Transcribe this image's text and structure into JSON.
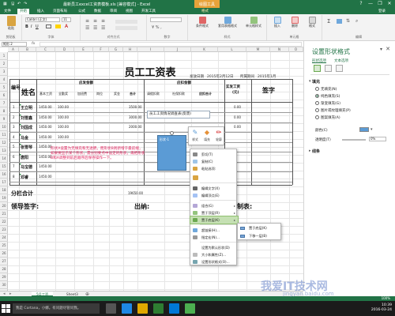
{
  "window": {
    "title": "最新员工excel工资表模板.xls [兼容模式] - Excel",
    "context_tab": "绘图工具",
    "controls": [
      "?",
      "—",
      "❐",
      "✕"
    ]
  },
  "ribbon": {
    "tabs": [
      "文件",
      "开始",
      "插入",
      "页面布局",
      "公式",
      "数据",
      "审阅",
      "视图",
      "开发工具",
      "格式"
    ],
    "active_tab": "开始",
    "groups": [
      "剪贴板",
      "字体",
      "对齐方式",
      "数字",
      "样式",
      "单元格",
      "编辑"
    ],
    "font_name": "Calibri (正文)",
    "font_size": "11",
    "buttons": {
      "paste": "粘贴",
      "conditional": "条件格式",
      "table_fmt": "套用表格格式",
      "cell_style": "单元格样式",
      "insert": "插入",
      "delete": "删除",
      "format": "格式"
    },
    "user": "登录"
  },
  "formula_bar": {
    "name_box": "矩形 2",
    "fx": "fx"
  },
  "columns": [
    "A",
    "B",
    "C",
    "D",
    "E",
    "F",
    "G",
    "H",
    "I",
    "J",
    "K",
    "L",
    "M",
    "N",
    "O"
  ],
  "rows": [
    "1",
    "2",
    "3",
    "4",
    "5",
    "6",
    "7",
    "8",
    "9",
    "10",
    "11",
    "12",
    "13",
    "14",
    "15",
    "16",
    "17",
    "18",
    "19",
    "20",
    "21",
    "22",
    "23",
    "24",
    "25",
    "26",
    "27",
    "28",
    "29",
    "30"
  ],
  "sheet": {
    "title": "员工工资表",
    "date_label": "发放日期",
    "date_value": "2015年2月12日",
    "period": "所属期间",
    "period_value": "2015年1月",
    "col_no": "编号",
    "col_name": "姓名",
    "group_payable": "应发金额",
    "group_deduct": "应扣金额",
    "col_sub": [
      "基本工资",
      "全勤奖",
      "加班费",
      "岗位",
      "奖金"
    ],
    "col_total": "合计",
    "col_deduct_sub": [
      "请假扣款",
      "社保扣款",
      "应扣合计"
    ],
    "col_actual": "实发工资",
    "col_actual_unit": "(元)",
    "col_sign": "签字",
    "ids": [
      "1",
      "2",
      "3",
      "4",
      "5",
      "6",
      "7",
      "8"
    ],
    "names": [
      "王立明",
      "刘雪鑫",
      "刘国成",
      "马金",
      "张雪琴",
      "唐阳",
      "马宝德",
      "邓睿"
    ],
    "base": [
      "1450.00",
      "1450.00",
      "1450.00",
      "1450.00",
      "1450.00",
      "1450.00",
      "1450.00",
      "1450.00"
    ],
    "bonus": [
      "100.00",
      "100.00",
      "100.00",
      "100.00"
    ],
    "totals": [
      "3500.00",
      "3000.00",
      "2000.00"
    ],
    "actuals": [
      "0.00",
      "0.00",
      "0.00"
    ],
    "subtotal_label": "分栏合计",
    "subtotal_value": "19650.00",
    "leader_sign": "领导签字:",
    "cashier": "出纳:",
    "maker": "制表:",
    "red_note": "形状A设置为无填充和无透明，而形状B则新增于最前端，如果要显示某个形状，需分别要点中设定的形状，再把形状B和A调整到前后顺序后保存操作一下。",
    "overlay_text": "员工工资情况调查表(反馈)",
    "shape_label": "形状-1"
  },
  "mini_toolbar": {
    "style": "样式",
    "fill": "填充",
    "outline": "轮廓"
  },
  "context_menu": {
    "items": [
      "剪切(T)",
      "复制(C)",
      "粘贴选项:",
      "编辑文字(X)",
      "编辑顶点(E)",
      "组合(G)",
      "置于顶层(R)",
      "置于底层(K)",
      "超链接(H)...",
      "指定宏(N)...",
      "设置为默认形状(D)",
      "大小和属性(Z)...",
      "设置形状格式(O)..."
    ],
    "highlighted": "置于底层(K)",
    "submenu": [
      "置于底层(K)",
      "下移一层(B)"
    ]
  },
  "pane": {
    "title": "设置形状格式",
    "tabs": [
      "形状选项",
      "文本选项"
    ],
    "section_fill": "填充",
    "fill_options": [
      "无填充(N)",
      "纯色填充(S)",
      "渐变填充(G)",
      "图片或纹理填充(P)",
      "图案填充(A)"
    ],
    "selected_fill": "纯色填充(S)",
    "color_label": "颜色(C)",
    "transparency_label": "透明度(T)",
    "transparency_value": "0%",
    "section_line": "线条",
    "fill_color": "#5b9bd5"
  },
  "sheet_tabs": [
    "5月工资",
    "Sheet3"
  ],
  "active_sheet": "5月工资",
  "status": {
    "zoom": "100%"
  },
  "taskbar": {
    "search": "我是 Cortana，小娜。有问题尽管问我。",
    "time": "10:39",
    "date": "2016-03-24"
  },
  "watermark": {
    "main": "我爱IT技术网",
    "sub": "jingyan.baidu.com"
  },
  "colors": {
    "excel_green": "#217346",
    "shape_blue": "#5b9bd5",
    "highlight": "#c5e0b3",
    "context_orange": "#e7a33a",
    "note_red": "#e0245e"
  }
}
